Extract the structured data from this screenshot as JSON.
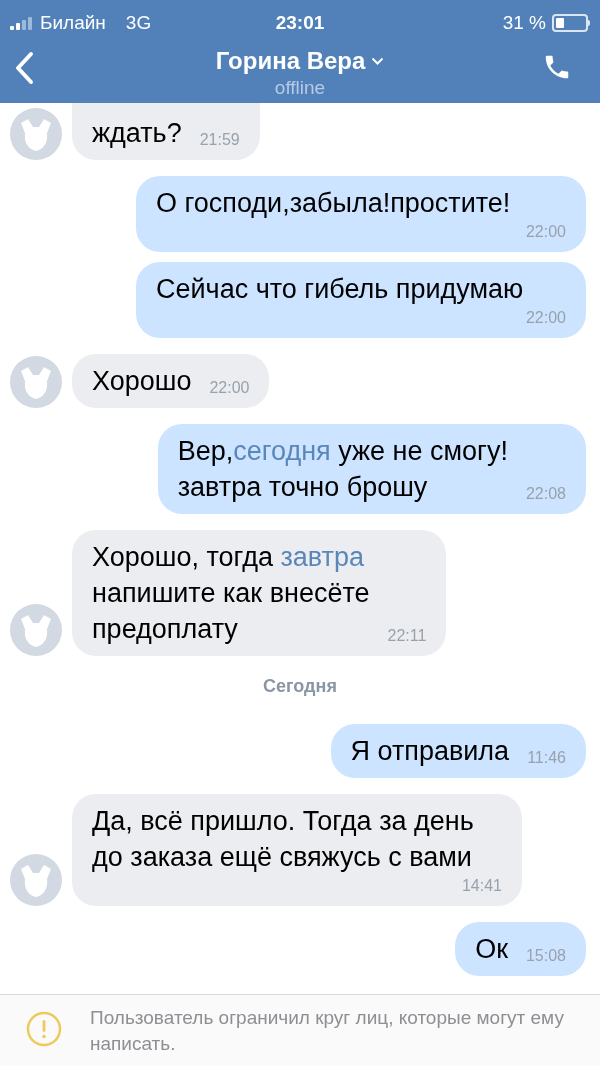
{
  "status_bar": {
    "carrier": "Билайн",
    "network": "3G",
    "time": "23:01",
    "battery": "31 %"
  },
  "header": {
    "title": "Горина Вера",
    "subtitle": "offline"
  },
  "messages": [
    {
      "kind": "incoming",
      "lines": [
        [
          {
            "text": "ждать?"
          }
        ]
      ],
      "time": "21:59"
    },
    {
      "kind": "outgoing",
      "lines": [
        [
          {
            "text": "О господи,забыла!простите!"
          }
        ]
      ],
      "time": "22:00"
    },
    {
      "kind": "outgoing",
      "lines": [
        [
          {
            "text": "Сейчас что гибель придумаю"
          }
        ]
      ],
      "time": "22:00"
    },
    {
      "kind": "incoming",
      "lines": [
        [
          {
            "text": "Хорошо"
          }
        ]
      ],
      "time": "22:00"
    },
    {
      "kind": "outgoing",
      "lines": [
        [
          {
            "text": "Вер,"
          },
          {
            "text": "сегодня",
            "kind": "link"
          },
          {
            "text": " уже не смогу!"
          }
        ],
        [
          {
            "text": "завтра точно брошу"
          }
        ]
      ],
      "time": "22:08"
    },
    {
      "kind": "incoming",
      "lines": [
        [
          {
            "text": "Хорошо, тогда "
          },
          {
            "text": "завтра",
            "kind": "link"
          }
        ],
        [
          {
            "text": "напишите как внесёте"
          }
        ],
        [
          {
            "text": "предоплату"
          }
        ]
      ],
      "time": "22:11"
    },
    {
      "kind": "separator",
      "label": "Сегодня"
    },
    {
      "kind": "outgoing",
      "lines": [
        [
          {
            "text": "Я отправила"
          }
        ]
      ],
      "time": "11:46"
    },
    {
      "kind": "incoming",
      "lines": [
        [
          {
            "text": "Да, всё пришло. Тогда за день"
          }
        ],
        [
          {
            "text": "до заказа ещё свяжусь с вами"
          }
        ]
      ],
      "time": "14:41"
    },
    {
      "kind": "outgoing",
      "lines": [
        [
          {
            "text": "Ок"
          }
        ]
      ],
      "time": "15:08"
    }
  ],
  "notice": {
    "text": "Пользователь ограничил круг лиц, которые могут ему написать."
  }
}
